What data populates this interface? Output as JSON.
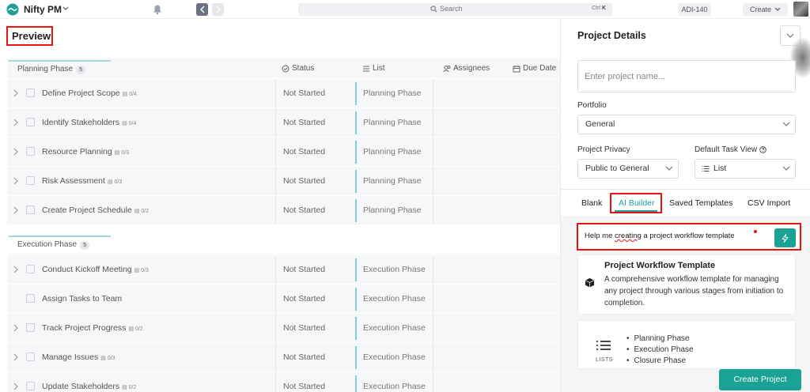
{
  "topbar": {
    "app_name": "Nifty PM",
    "search_placeholder": "Search",
    "search_shortcut_prefix": "Ctrl",
    "search_shortcut_key": "K",
    "project_tag": "ADI-140",
    "create_label": "Create"
  },
  "preview": {
    "title": "Preview",
    "columns": {
      "status": "Status",
      "list": "List",
      "assignees": "Assignees",
      "due_date": "Due Date"
    },
    "phases": [
      {
        "name": "Planning Phase",
        "count": "5",
        "tasks": [
          {
            "name": "Define Project Scope",
            "sub": "0/4",
            "status": "Not Started",
            "list": "Planning Phase"
          },
          {
            "name": "Identify Stakeholders",
            "sub": "0/4",
            "status": "Not Started",
            "list": "Planning Phase"
          },
          {
            "name": "Resource Planning",
            "sub": "0/3",
            "status": "Not Started",
            "list": "Planning Phase"
          },
          {
            "name": "Risk Assessment",
            "sub": "0/3",
            "status": "Not Started",
            "list": "Planning Phase"
          },
          {
            "name": "Create Project Schedule",
            "sub": "0/2",
            "status": "Not Started",
            "list": "Planning Phase"
          }
        ]
      },
      {
        "name": "Execution Phase",
        "count": "5",
        "tasks": [
          {
            "name": "Conduct Kickoff Meeting",
            "sub": "0/3",
            "status": "Not Started",
            "list": "Execution Phase"
          },
          {
            "name": "Assign Tasks to Team",
            "sub": "",
            "status": "Not Started",
            "list": "Execution Phase"
          },
          {
            "name": "Track Project Progress",
            "sub": "0/2",
            "status": "Not Started",
            "list": "Execution Phase"
          },
          {
            "name": "Manage Issues",
            "sub": "0/3",
            "status": "Not Started",
            "list": "Execution Phase"
          },
          {
            "name": "Update Stakeholders",
            "sub": "0/2",
            "status": "Not Started",
            "list": "Execution Phase"
          }
        ]
      }
    ]
  },
  "panel": {
    "title": "Project Details",
    "name_placeholder": "Enter project name...",
    "portfolio_label": "Portfolio",
    "portfolio_value": "General",
    "privacy_label": "Project Privacy",
    "privacy_value": "Public to General",
    "view_label": "Default Task View",
    "view_value": "List",
    "tabs": {
      "blank": "Blank",
      "ai_builder": "AI Builder",
      "saved": "Saved Templates",
      "csv": "CSV Import"
    },
    "prompt_before": "Help me ",
    "prompt_misspelled": "creating",
    "prompt_after": " a project workflow template",
    "template_title": "Project Workflow Template",
    "template_desc": "A comprehensive workflow template for managing any project through various stages from initiation to completion.",
    "lists_caption": "LISTS",
    "lists": [
      "Planning Phase",
      "Execution Phase",
      "Closure Phase"
    ],
    "create_button": "Create Project"
  },
  "colors": {
    "accent": "#1aa394",
    "highlight": "#ee1111",
    "list_bar": "#7fd1d6"
  }
}
